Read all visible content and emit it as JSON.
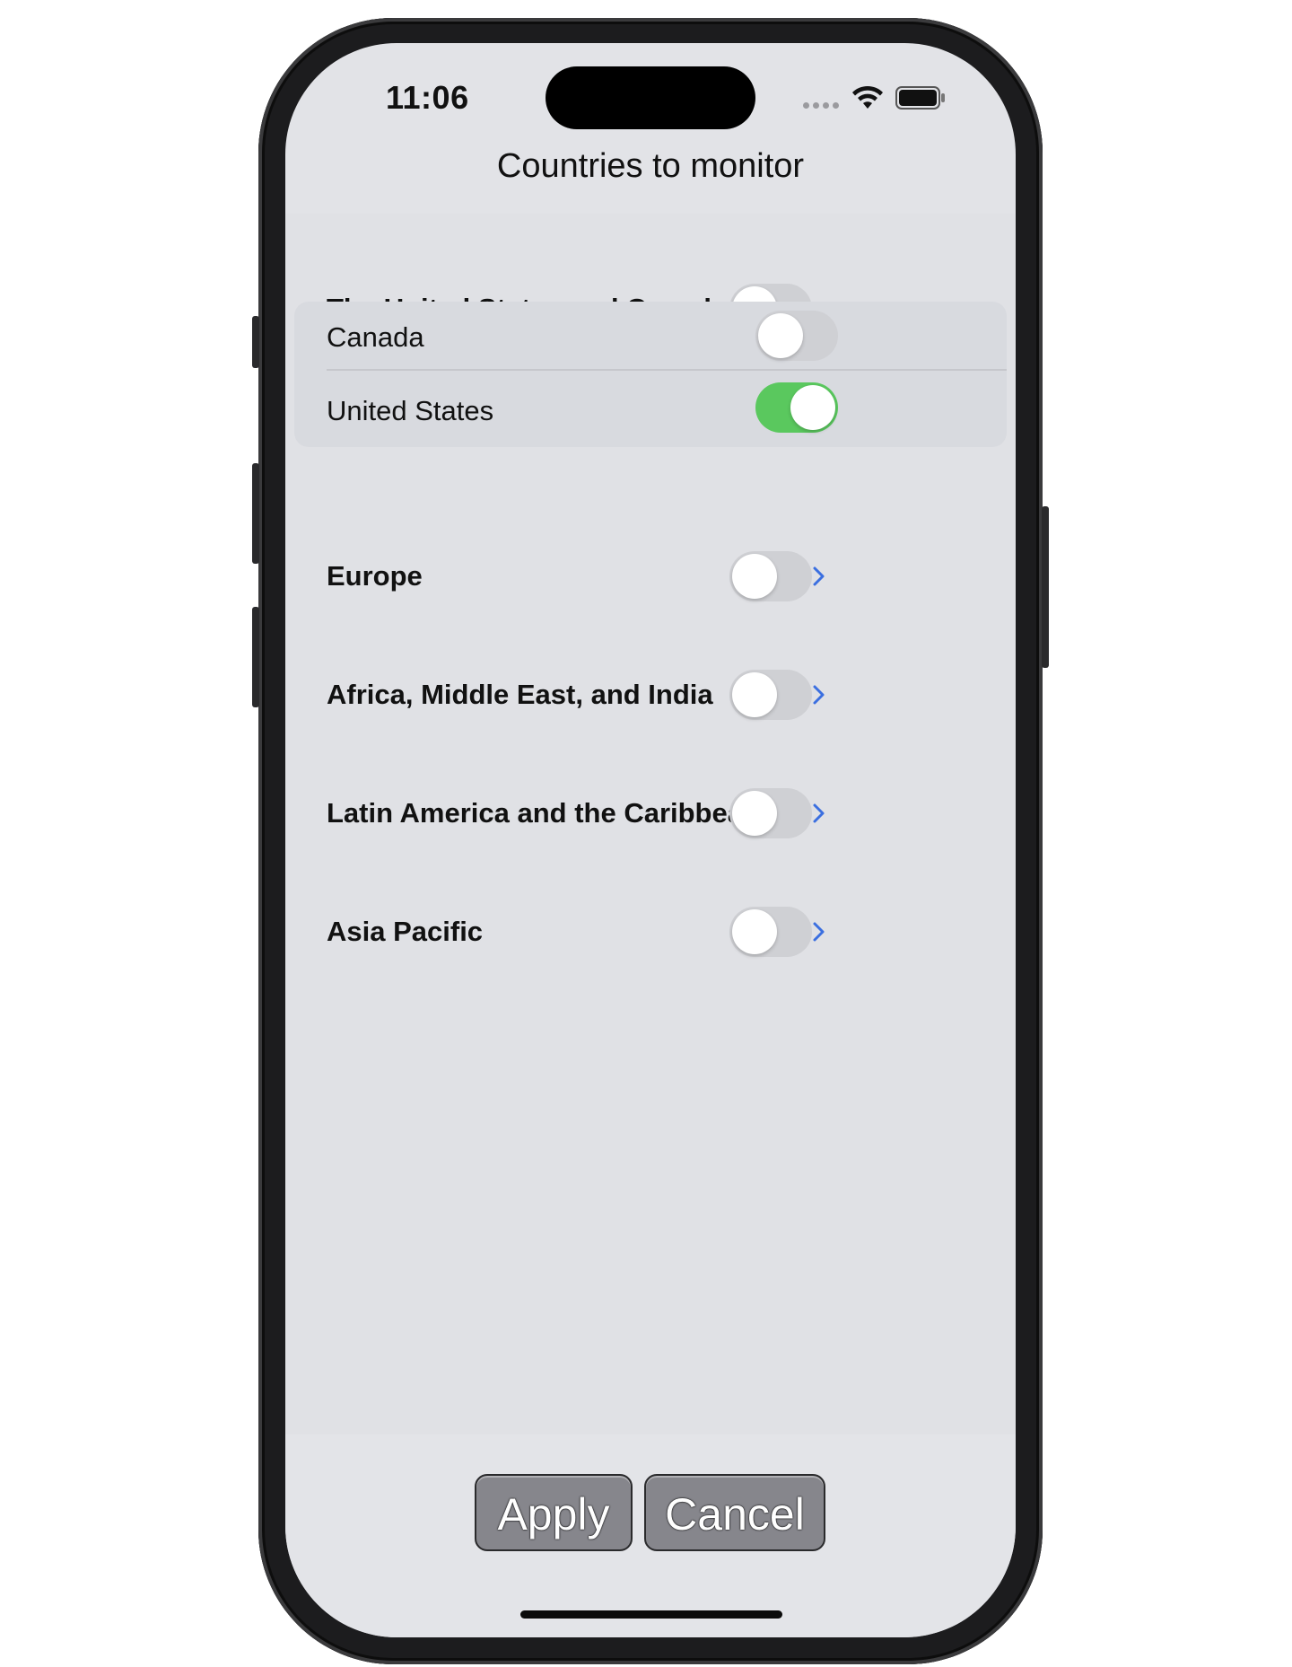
{
  "status_bar": {
    "time": "11:06"
  },
  "header": {
    "title": "Countries to monitor"
  },
  "regions": [
    {
      "label": "The United States and Canada",
      "enabled": false,
      "expanded": true,
      "chevron": "chevron-down-icon"
    },
    {
      "label": "Europe",
      "enabled": false,
      "expanded": false,
      "chevron": "chevron-right-icon"
    },
    {
      "label": "Africa, Middle East, and India",
      "enabled": false,
      "expanded": false,
      "chevron": "chevron-right-icon"
    },
    {
      "label": "Latin America and the Caribbean",
      "enabled": false,
      "expanded": false,
      "chevron": "chevron-right-icon"
    },
    {
      "label": "Asia Pacific",
      "enabled": false,
      "expanded": false,
      "chevron": "chevron-right-icon"
    }
  ],
  "sub_countries": [
    {
      "label": "Canada",
      "enabled": false
    },
    {
      "label": "United States",
      "enabled": true
    }
  ],
  "actions": {
    "apply_label": "Apply",
    "cancel_label": "Cancel"
  },
  "colors": {
    "toggle_on": "#5ac85e",
    "toggle_off": "#cfd0d4",
    "chevron": "#3b6fe0",
    "button_bg": "#86868c"
  }
}
